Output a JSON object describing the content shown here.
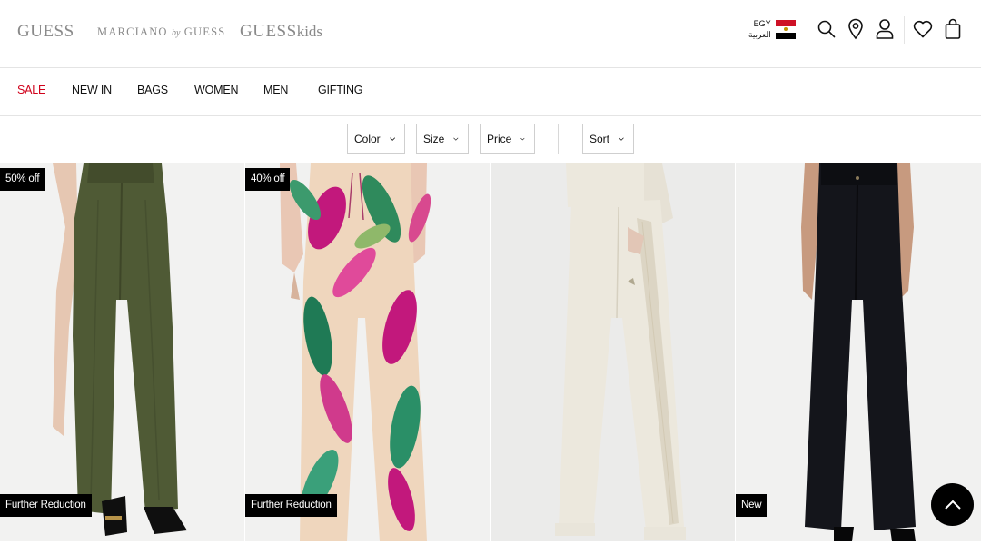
{
  "header": {
    "brands": {
      "guess": "GUESS",
      "marciano_main": "MARCIANO",
      "marciano_by": "by",
      "marciano_guess": "GUESS",
      "kids_main": "GUESS",
      "kids_suffix": "kids"
    },
    "locale": {
      "country": "EGY",
      "language": "العربية"
    },
    "icons": [
      "search-icon",
      "location-pin-icon",
      "account-icon",
      "wishlist-heart-icon",
      "shopping-bag-icon"
    ]
  },
  "nav": {
    "items": [
      "SALE",
      "NEW IN",
      "BAGS",
      "WOMEN",
      "MEN",
      "GIFTING"
    ]
  },
  "filters": {
    "color": "Color",
    "size": "Size",
    "price": "Price",
    "sort": "Sort"
  },
  "products": [
    {
      "top_badge": "50% off",
      "bottom_badge": "Further Reduction",
      "garment_color": "#4f5a35"
    },
    {
      "top_badge": "40% off",
      "bottom_badge": "Further Reduction",
      "garment_color": "#e9c7b4"
    },
    {
      "top_badge": "",
      "bottom_badge": "",
      "garment_color": "#ece8dd"
    },
    {
      "top_badge": "",
      "bottom_badge": "New",
      "garment_color": "#14151b"
    }
  ],
  "colors": {
    "sale_red": "#d0021b",
    "badge_bg": "#000000",
    "brand_grey": "#8a8a8a",
    "border": "#e4e4e4"
  }
}
